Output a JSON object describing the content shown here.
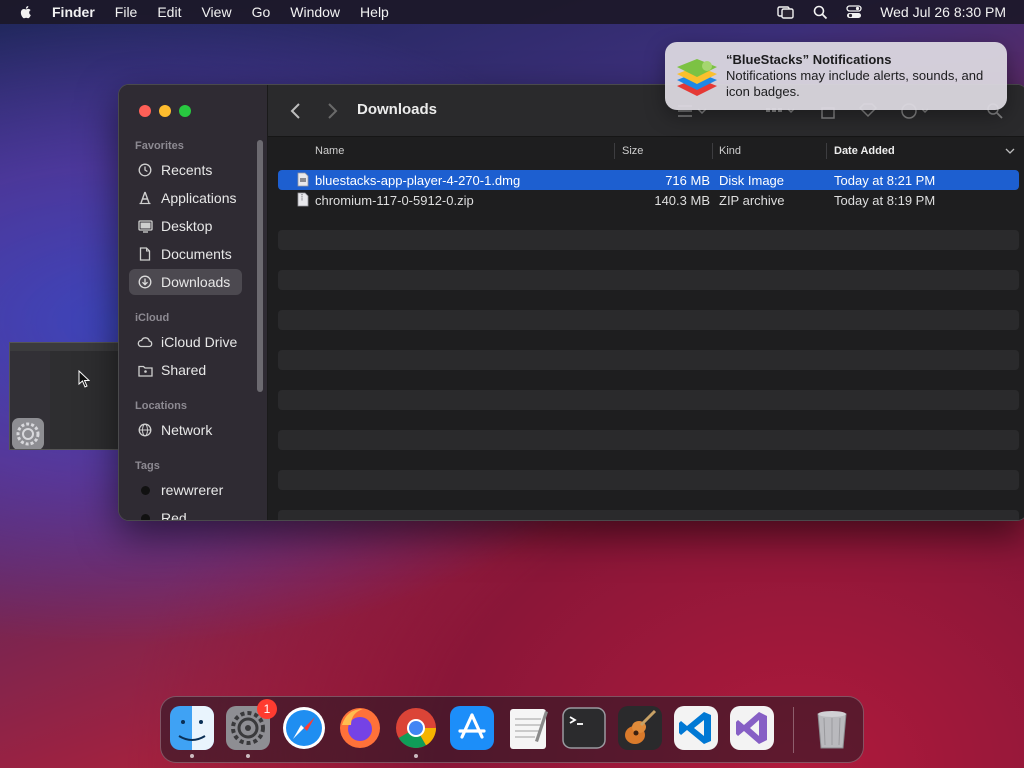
{
  "menubar": {
    "app_name": "Finder",
    "menus": [
      "File",
      "Edit",
      "View",
      "Go",
      "Window",
      "Help"
    ],
    "clock": "Wed Jul 26  8:30 PM",
    "icons": [
      "apple-icon",
      "screen-mirroring-icon",
      "spotlight-search-icon",
      "control-center-icon"
    ]
  },
  "notification": {
    "title": "“BlueStacks” Notifications",
    "body": "Notifications may include alerts, sounds, and icon badges."
  },
  "finder": {
    "title": "Downloads",
    "sidebar": {
      "favorites_label": "Favorites",
      "favorites": [
        {
          "label": "Recents",
          "icon": "clock-icon"
        },
        {
          "label": "Applications",
          "icon": "applications-icon"
        },
        {
          "label": "Desktop",
          "icon": "desktop-icon"
        },
        {
          "label": "Documents",
          "icon": "document-icon"
        },
        {
          "label": "Downloads",
          "icon": "download-icon",
          "selected": true
        }
      ],
      "icloud_label": "iCloud",
      "icloud": [
        {
          "label": "iCloud Drive",
          "icon": "cloud-icon"
        },
        {
          "label": "Shared",
          "icon": "shared-folder-icon"
        }
      ],
      "locations_label": "Locations",
      "locations": [
        {
          "label": "Network",
          "icon": "globe-icon"
        }
      ],
      "tags_label": "Tags",
      "tags": [
        {
          "label": "rewwrerer",
          "color": "#111111"
        },
        {
          "label": "Red",
          "color": "#111111"
        }
      ]
    },
    "columns": {
      "name": "Name",
      "size": "Size",
      "kind": "Kind",
      "date_added": "Date Added"
    },
    "files": [
      {
        "name": "bluestacks-app-player-4-270-1.dmg",
        "size": "716 MB",
        "kind": "Disk Image",
        "date_added": "Today at 8:21 PM",
        "selected": true
      },
      {
        "name": "chromium-117-0-5912-0.zip",
        "size": "140.3 MB",
        "kind": "ZIP archive",
        "date_added": "Today at 8:19 PM",
        "selected": false
      }
    ]
  },
  "dock": {
    "apps": [
      {
        "name": "Finder",
        "running": true
      },
      {
        "name": "System Settings",
        "running": true,
        "badge": "1"
      },
      {
        "name": "Safari",
        "running": false
      },
      {
        "name": "Firefox",
        "running": false
      },
      {
        "name": "Google Chrome",
        "running": true
      },
      {
        "name": "App Store",
        "running": false
      },
      {
        "name": "TextEdit",
        "running": false
      },
      {
        "name": "Terminal",
        "running": false
      },
      {
        "name": "GarageBand",
        "running": false
      },
      {
        "name": "Visual Studio Code",
        "running": false
      },
      {
        "name": "Visual Studio",
        "running": false
      },
      {
        "name": "Trash",
        "running": false
      }
    ]
  },
  "colors": {
    "selection": "#1d5fd0",
    "badge": "#ff3b30",
    "close": "#fe5f57",
    "minimize": "#febc2e",
    "maximize": "#28c840"
  }
}
